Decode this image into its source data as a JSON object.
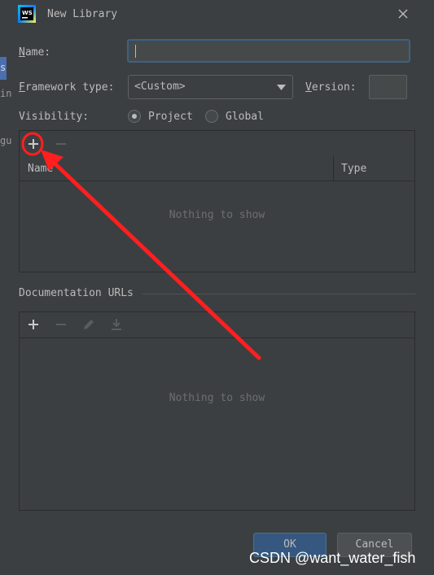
{
  "window": {
    "title": "New Library",
    "app_icon": "webstorm-logo-icon",
    "app_icon_text": "WS"
  },
  "background": {
    "fragments": [
      "s",
      "in",
      "gu"
    ]
  },
  "form": {
    "name_label": "Name:",
    "name_value": "",
    "framework_label": "Framework type:",
    "framework_value": "<Custom>",
    "version_label": "Version:",
    "version_value": "",
    "visibility_label": "Visibility:",
    "visibility_options": [
      {
        "label": "Project",
        "selected": true
      },
      {
        "label": "Global",
        "selected": false
      }
    ]
  },
  "classes_panel": {
    "toolbar": [
      "add-icon",
      "remove-icon"
    ],
    "columns": [
      "Name",
      "Type"
    ],
    "empty_text": "Nothing to show"
  },
  "documentation": {
    "heading": "Documentation URLs",
    "toolbar": [
      "add-icon",
      "remove-icon",
      "edit-icon",
      "download-icon"
    ],
    "empty_text": "Nothing to show"
  },
  "buttons": {
    "ok": "OK",
    "cancel": "Cancel"
  },
  "watermark": "CSDN @want_water_fish",
  "colors": {
    "annotation_red": "#ff1f1f",
    "accent_blue": "#365880",
    "focus_border": "#3d6185"
  }
}
